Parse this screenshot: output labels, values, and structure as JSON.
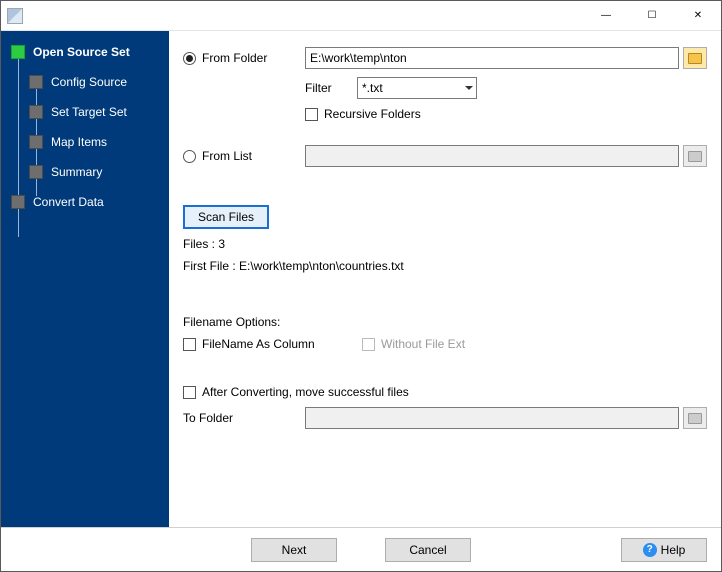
{
  "window": {
    "minimize": "—",
    "maximize": "☐",
    "close": "✕"
  },
  "sidebar": {
    "items": [
      {
        "label": "Open Source Set",
        "current": true
      },
      {
        "label": "Config Source"
      },
      {
        "label": "Set Target Set"
      },
      {
        "label": "Map Items"
      },
      {
        "label": "Summary"
      },
      {
        "label": "Convert Data"
      }
    ]
  },
  "main": {
    "from_folder_label": "From Folder",
    "from_folder_value": "E:\\work\\temp\\nton",
    "filter_label": "Filter",
    "filter_value": "*.txt",
    "recursive_label": "Recursive Folders",
    "from_list_label": "From List",
    "from_list_value": "",
    "scan_button": "Scan Files",
    "files_count_label": "Files : 3",
    "first_file_label": "First File : E:\\work\\temp\\nton\\countries.txt",
    "filename_options_header": "Filename Options:",
    "filename_as_column_label": "FileName As Column",
    "without_ext_label": "Without File Ext",
    "after_converting_label": "After Converting, move successful files",
    "to_folder_label": "To Folder",
    "to_folder_value": ""
  },
  "footer": {
    "next": "Next",
    "cancel": "Cancel",
    "help": "Help"
  }
}
